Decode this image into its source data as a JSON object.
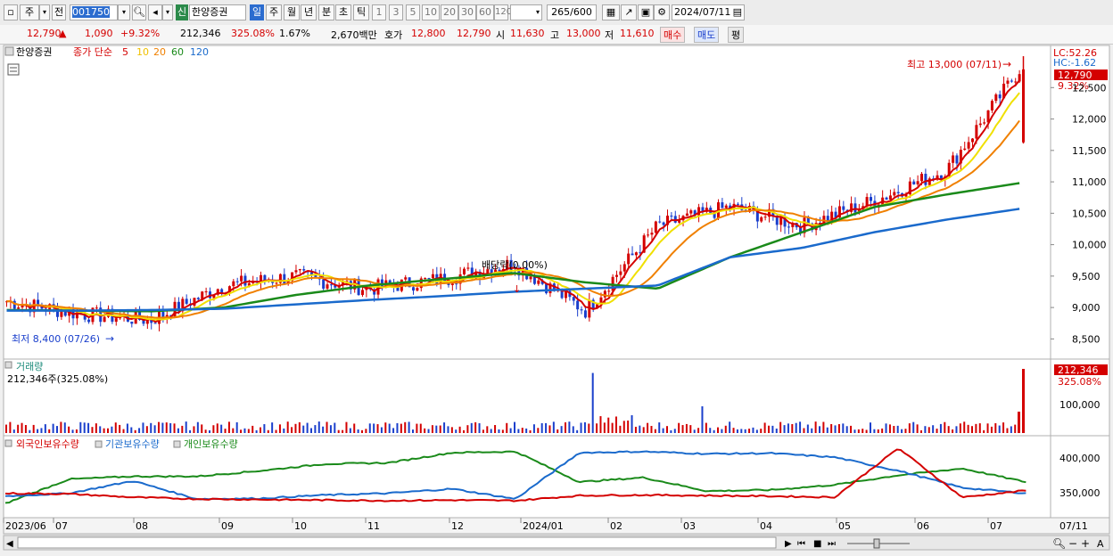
{
  "toolbar": {
    "market": "주",
    "prev_label": "전",
    "code": "001750",
    "new_badge": "신",
    "name": "한양증권",
    "periods": [
      "일",
      "주",
      "월",
      "년",
      "분",
      "초",
      "틱"
    ],
    "selected_period": "일",
    "intervals": [
      "1",
      "3",
      "5",
      "10",
      "20",
      "30",
      "60",
      "120"
    ],
    "count": "265",
    "count_total": "/600",
    "date": "2024/07/11"
  },
  "quote": {
    "price": "12,790",
    "arrow": "▲",
    "change": "1,090",
    "change_pct": "+9.32%",
    "volume": "212,346",
    "volume_ratio": "325.08%",
    "turnover_pct": "1.67%",
    "amount": "2,670백만",
    "ask_label": "호가",
    "ask": "12,800",
    "bid": "12,790",
    "open_label": "시",
    "open": "11,630",
    "high_label": "고",
    "high": "13,000",
    "low_label": "저",
    "low": "11,610",
    "buy_label": "매수",
    "sell_label": "매도",
    "eval_label": "평"
  },
  "price_panel": {
    "stock_label": "한양증권",
    "ma_label": "종가 단순",
    "ma_periods": [
      {
        "label": "5",
        "color": "#d40000"
      },
      {
        "label": "10",
        "color": "#f0c000"
      },
      {
        "label": "20",
        "color": "#f08000"
      },
      {
        "label": "60",
        "color": "#1a8a1a"
      },
      {
        "label": "120",
        "color": "#1a6acc"
      }
    ],
    "lc_label": "LC:52.26",
    "hc_label": "HC:-1.62",
    "high_annotation": "최고 13,000 (07/11)",
    "low_annotation": "최저 8,400 (07/26)",
    "event_annotation": "배당락(0.00%)",
    "current_price_tag": "12,790",
    "current_pct_tag": "9.32%",
    "y_ticks": [
      "12,500",
      "12,000",
      "11,500",
      "11,000",
      "10,500",
      "10,000",
      "9,500",
      "9,000",
      "8,500"
    ]
  },
  "volume_panel": {
    "title": "거래량",
    "value_text": "212,346주(325.08%)",
    "tag_value": "212,346",
    "tag_pct": "325.08%",
    "y_ticks": [
      "100,000"
    ]
  },
  "holdings_panel": {
    "legend": [
      {
        "label": "외국인보유수량",
        "color": "#d40000"
      },
      {
        "label": "기관보유수량",
        "color": "#1a6acc"
      },
      {
        "label": "개인보유수량",
        "color": "#1a8a1a"
      }
    ],
    "y_ticks": [
      "400,000",
      "350,000"
    ]
  },
  "x_axis": {
    "labels": [
      "2023/06",
      "07",
      "08",
      "09",
      "10",
      "11",
      "12",
      "2024/01",
      "02",
      "03",
      "04",
      "05",
      "06",
      "07"
    ],
    "right_label": "07/11"
  },
  "colors": {
    "up": "#d40000",
    "down": "#1a3fcc",
    "ma5": "#d40000",
    "ma10": "#f0e000",
    "ma20": "#f08000",
    "ma60": "#1a8a1a",
    "ma120": "#1a6acc"
  },
  "chart_data": {
    "type": "line",
    "x": [
      "2023/06",
      "07",
      "08",
      "09",
      "10",
      "11",
      "12",
      "2024/01",
      "02",
      "03",
      "04",
      "05",
      "06",
      "07",
      "07/11"
    ],
    "series": [
      {
        "name": "종가",
        "values": [
          9100,
          8900,
          8800,
          9350,
          9500,
          9300,
          9450,
          9700,
          8950,
          10300,
          10600,
          10300,
          10700,
          11200,
          12790
        ]
      },
      {
        "name": "60",
        "values": [
          8960,
          8950,
          8940,
          9000,
          9200,
          9350,
          9450,
          9550,
          9400,
          9300,
          9800,
          10200,
          10600,
          10800,
          10980
        ]
      },
      {
        "name": "120",
        "values": [
          8950,
          8950,
          8960,
          8980,
          9050,
          9120,
          9180,
          9250,
          9300,
          9350,
          9800,
          9950,
          10200,
          10400,
          10570
        ]
      }
    ],
    "ylim": [
      8250,
      13100
    ],
    "high": 13000,
    "low": 8400
  }
}
